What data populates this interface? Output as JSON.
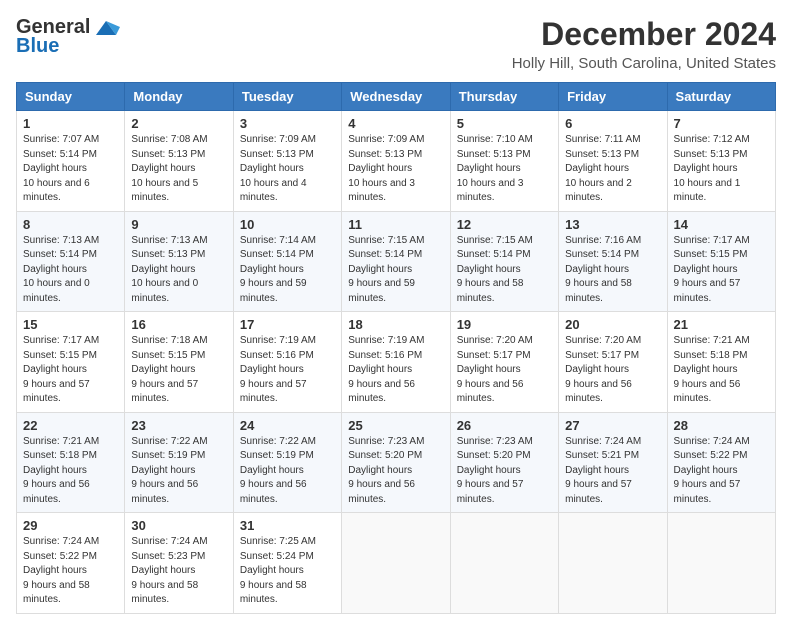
{
  "header": {
    "logo_line1": "General",
    "logo_line2": "Blue",
    "month": "December 2024",
    "location": "Holly Hill, South Carolina, United States"
  },
  "weekdays": [
    "Sunday",
    "Monday",
    "Tuesday",
    "Wednesday",
    "Thursday",
    "Friday",
    "Saturday"
  ],
  "weeks": [
    [
      {
        "day": "1",
        "sunrise": "7:07 AM",
        "sunset": "5:14 PM",
        "daylight": "10 hours and 6 minutes."
      },
      {
        "day": "2",
        "sunrise": "7:08 AM",
        "sunset": "5:13 PM",
        "daylight": "10 hours and 5 minutes."
      },
      {
        "day": "3",
        "sunrise": "7:09 AM",
        "sunset": "5:13 PM",
        "daylight": "10 hours and 4 minutes."
      },
      {
        "day": "4",
        "sunrise": "7:09 AM",
        "sunset": "5:13 PM",
        "daylight": "10 hours and 3 minutes."
      },
      {
        "day": "5",
        "sunrise": "7:10 AM",
        "sunset": "5:13 PM",
        "daylight": "10 hours and 3 minutes."
      },
      {
        "day": "6",
        "sunrise": "7:11 AM",
        "sunset": "5:13 PM",
        "daylight": "10 hours and 2 minutes."
      },
      {
        "day": "7",
        "sunrise": "7:12 AM",
        "sunset": "5:13 PM",
        "daylight": "10 hours and 1 minute."
      }
    ],
    [
      {
        "day": "8",
        "sunrise": "7:13 AM",
        "sunset": "5:14 PM",
        "daylight": "10 hours and 0 minutes."
      },
      {
        "day": "9",
        "sunrise": "7:13 AM",
        "sunset": "5:13 PM",
        "daylight": "10 hours and 0 minutes."
      },
      {
        "day": "10",
        "sunrise": "7:14 AM",
        "sunset": "5:14 PM",
        "daylight": "9 hours and 59 minutes."
      },
      {
        "day": "11",
        "sunrise": "7:15 AM",
        "sunset": "5:14 PM",
        "daylight": "9 hours and 59 minutes."
      },
      {
        "day": "12",
        "sunrise": "7:15 AM",
        "sunset": "5:14 PM",
        "daylight": "9 hours and 58 minutes."
      },
      {
        "day": "13",
        "sunrise": "7:16 AM",
        "sunset": "5:14 PM",
        "daylight": "9 hours and 58 minutes."
      },
      {
        "day": "14",
        "sunrise": "7:17 AM",
        "sunset": "5:15 PM",
        "daylight": "9 hours and 57 minutes."
      }
    ],
    [
      {
        "day": "15",
        "sunrise": "7:17 AM",
        "sunset": "5:15 PM",
        "daylight": "9 hours and 57 minutes."
      },
      {
        "day": "16",
        "sunrise": "7:18 AM",
        "sunset": "5:15 PM",
        "daylight": "9 hours and 57 minutes."
      },
      {
        "day": "17",
        "sunrise": "7:19 AM",
        "sunset": "5:16 PM",
        "daylight": "9 hours and 57 minutes."
      },
      {
        "day": "18",
        "sunrise": "7:19 AM",
        "sunset": "5:16 PM",
        "daylight": "9 hours and 56 minutes."
      },
      {
        "day": "19",
        "sunrise": "7:20 AM",
        "sunset": "5:17 PM",
        "daylight": "9 hours and 56 minutes."
      },
      {
        "day": "20",
        "sunrise": "7:20 AM",
        "sunset": "5:17 PM",
        "daylight": "9 hours and 56 minutes."
      },
      {
        "day": "21",
        "sunrise": "7:21 AM",
        "sunset": "5:18 PM",
        "daylight": "9 hours and 56 minutes."
      }
    ],
    [
      {
        "day": "22",
        "sunrise": "7:21 AM",
        "sunset": "5:18 PM",
        "daylight": "9 hours and 56 minutes."
      },
      {
        "day": "23",
        "sunrise": "7:22 AM",
        "sunset": "5:19 PM",
        "daylight": "9 hours and 56 minutes."
      },
      {
        "day": "24",
        "sunrise": "7:22 AM",
        "sunset": "5:19 PM",
        "daylight": "9 hours and 56 minutes."
      },
      {
        "day": "25",
        "sunrise": "7:23 AM",
        "sunset": "5:20 PM",
        "daylight": "9 hours and 56 minutes."
      },
      {
        "day": "26",
        "sunrise": "7:23 AM",
        "sunset": "5:20 PM",
        "daylight": "9 hours and 57 minutes."
      },
      {
        "day": "27",
        "sunrise": "7:24 AM",
        "sunset": "5:21 PM",
        "daylight": "9 hours and 57 minutes."
      },
      {
        "day": "28",
        "sunrise": "7:24 AM",
        "sunset": "5:22 PM",
        "daylight": "9 hours and 57 minutes."
      }
    ],
    [
      {
        "day": "29",
        "sunrise": "7:24 AM",
        "sunset": "5:22 PM",
        "daylight": "9 hours and 58 minutes."
      },
      {
        "day": "30",
        "sunrise": "7:24 AM",
        "sunset": "5:23 PM",
        "daylight": "9 hours and 58 minutes."
      },
      {
        "day": "31",
        "sunrise": "7:25 AM",
        "sunset": "5:24 PM",
        "daylight": "9 hours and 58 minutes."
      },
      null,
      null,
      null,
      null
    ]
  ]
}
